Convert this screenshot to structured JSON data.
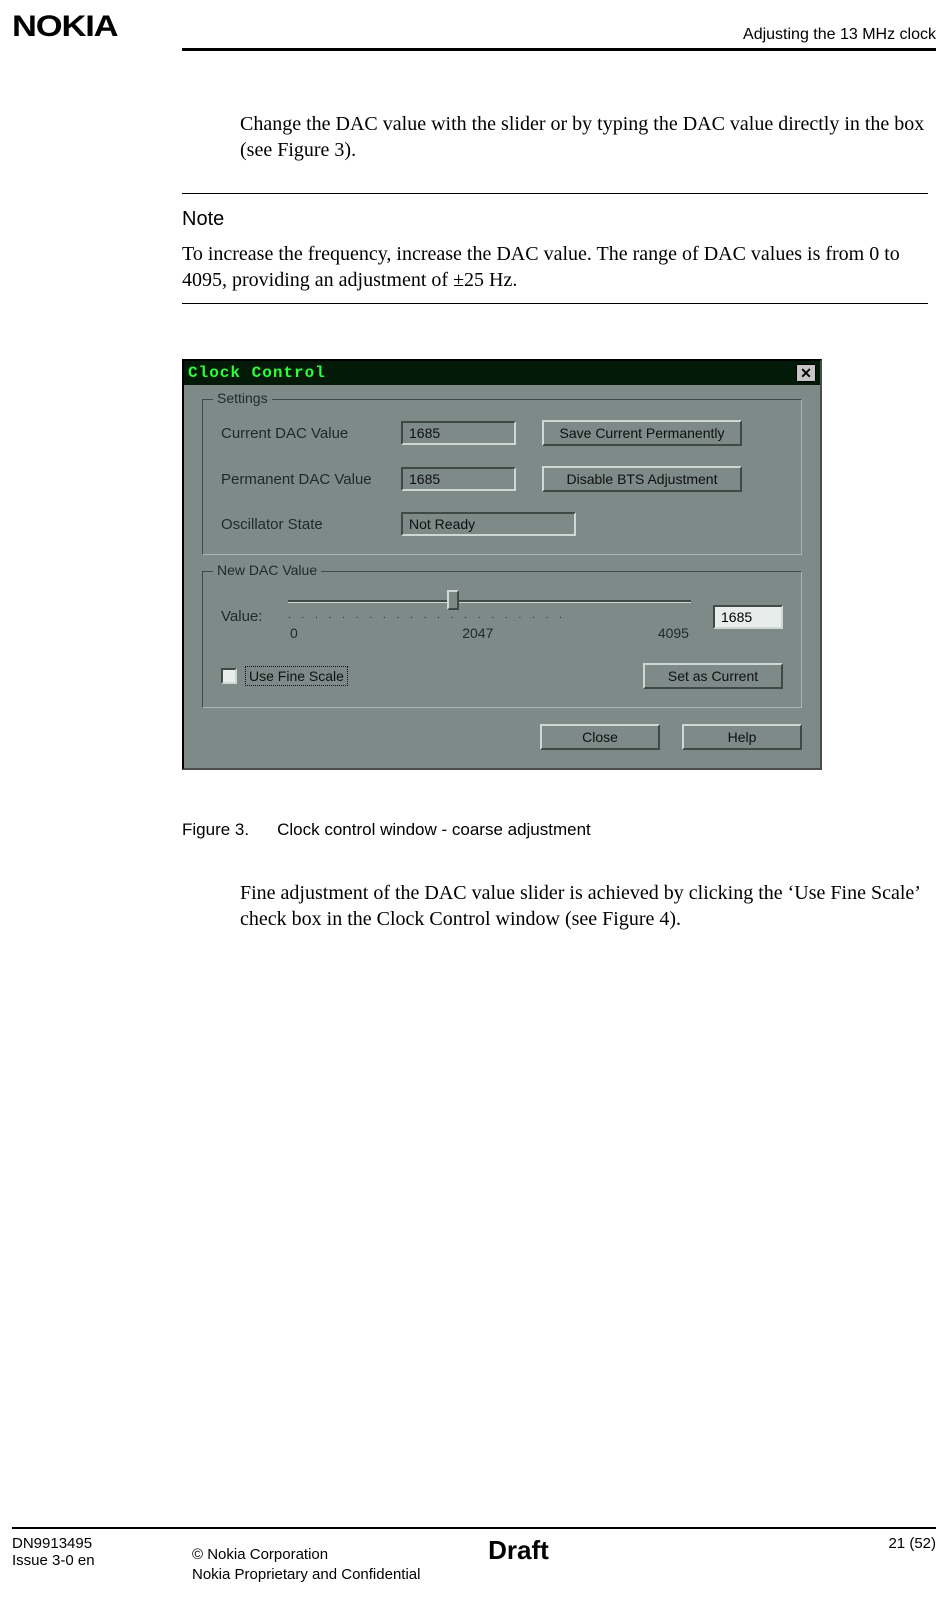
{
  "header": {
    "logo": "NOKIA",
    "section_title": "Adjusting the 13 MHz clock"
  },
  "body": {
    "intro": "Change the DAC value with the slider or by typing the DAC value directly in the box (see Figure 3).",
    "note_heading": "Note",
    "note_text": "To increase the frequency, increase the DAC value. The range of DAC values is from 0 to 4095, providing an adjustment of ±25 Hz.",
    "figure_caption_prefix": "Figure 3.",
    "figure_caption_text": "Clock control window - coarse adjustment",
    "outro": "Fine adjustment of the DAC value slider is achieved by clicking the ‘Use Fine Scale’ check box in the Clock Control window (see Figure 4)."
  },
  "window": {
    "title": "Clock Control",
    "close_glyph": "✕",
    "settings_legend": "Settings",
    "current_dac_label": "Current DAC Value",
    "current_dac_value": "1685",
    "save_btn": "Save Current Permanently",
    "permanent_dac_label": "Permanent DAC Value",
    "permanent_dac_value": "1685",
    "disable_btn": "Disable BTS Adjustment",
    "osc_state_label": "Oscillator State",
    "osc_state_value": "Not Ready",
    "newdac_legend": "New DAC Value",
    "value_label": "Value:",
    "slider_min": "0",
    "slider_mid": "2047",
    "slider_max": "4095",
    "slider_value": "1685",
    "slider_percent": 41,
    "fine_scale_label": "Use Fine Scale",
    "set_current_btn": "Set as Current",
    "close_btn": "Close",
    "help_btn": "Help"
  },
  "footer": {
    "doc_id": "DN9913495",
    "issue": "Issue 3-0 en",
    "copyright": "© Nokia Corporation",
    "confidential": "Nokia Proprietary and Confidential",
    "status": "Draft",
    "page": "21 (52)"
  }
}
